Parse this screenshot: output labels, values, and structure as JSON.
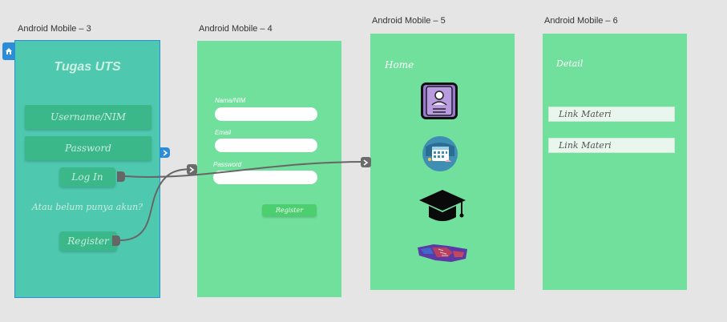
{
  "artboards": {
    "a3": {
      "title": "Android Mobile – 3"
    },
    "a4": {
      "title": "Android Mobile – 4"
    },
    "a5": {
      "title": "Android Mobile – 5"
    },
    "a6": {
      "title": "Android Mobile – 6"
    }
  },
  "screen3": {
    "title": "Tugas UTS",
    "username_placeholder": "Username/NIM",
    "password_placeholder": "Password",
    "login_label": "Log In",
    "question": "Atau belum punya akun?",
    "register_label": "Register"
  },
  "screen4": {
    "nama_label": "Nama/NIM",
    "email_label": "Email",
    "password_label": "Password",
    "register_label": "Register"
  },
  "screen5": {
    "home_label": "Home",
    "icons": [
      "profile-card-icon",
      "calendar-icon",
      "graduation-cap-icon",
      "handshake-icon"
    ]
  },
  "screen6": {
    "detail_label": "Detail",
    "links": [
      "Link Materi",
      "Link Materi"
    ]
  },
  "colors": {
    "screen3_bg": "#4ec9b0",
    "screen_bg": "#71e09c",
    "selection_blue": "#2b8cd8",
    "wire": "#666666"
  }
}
